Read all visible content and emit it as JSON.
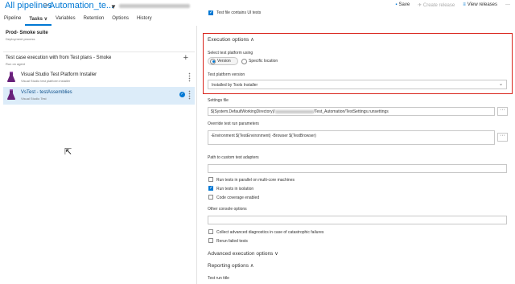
{
  "breadcrumb": {
    "all_pipelines": "All pipelines",
    "separator": ">",
    "pipeline_name": "Automation_te..."
  },
  "top_actions": {
    "save": "Save",
    "create_release": "Create release",
    "view_releases": "View releases"
  },
  "tabs": [
    {
      "label": "Pipeline"
    },
    {
      "label": "Tasks ∨"
    },
    {
      "label": "Variables"
    },
    {
      "label": "Retention"
    },
    {
      "label": "Options"
    },
    {
      "label": "History"
    }
  ],
  "stage": {
    "title": "Prod- Smoke suite",
    "subtitle": "Deployment process"
  },
  "job": {
    "title": "Test case execution with from Test plans - Smoke",
    "subtitle": "Run on agent"
  },
  "tasks": [
    {
      "title": "Visual Studio Test Platform Installer",
      "subtitle": "Visual Studio test platform installer"
    },
    {
      "title": "VsTest - testAssemblies",
      "subtitle": "Visual Studio Test"
    }
  ],
  "form": {
    "top_checkbox_label": "Test file contains UI tests",
    "execution_options_title": "Execution options ∧",
    "select_platform_label": "Select test platform using",
    "radio_version": "Version",
    "radio_specific_location": "Specific location",
    "platform_version_label": "Test platform version",
    "platform_version_value": "Installed by Tools Installer",
    "settings_file_label": "Settings file",
    "settings_file_value_prefix": "$(System.DefaultWorkingDirectory)/",
    "settings_file_value_suffix": "/Test_Automation/TestSettings.runsettings",
    "override_label": "Override test run parameters",
    "override_value": "-Environment $(TestEnvironment) -Browser $(TestBrowser)",
    "adapters_label": "Path to custom test adapters",
    "run_parallel_label": "Run tests in parallel on multi-core machines",
    "run_isolation_label": "Run tests in isolation",
    "code_coverage_label": "Code coverage enabled",
    "console_options_label": "Other console options",
    "collect_diag_label": "Collect advanced diagnostics in case of catastrophic failures",
    "rerun_label": "Rerun failed tests",
    "advanced_section": "Advanced execution options ∨",
    "reporting_section": "Reporting options ∧",
    "test_run_title_label": "Test run title",
    "more_button": "···"
  },
  "colors": {
    "accent": "#0078d4",
    "highlight_border": "#d9241c",
    "selected_row": "#dcecf9"
  }
}
